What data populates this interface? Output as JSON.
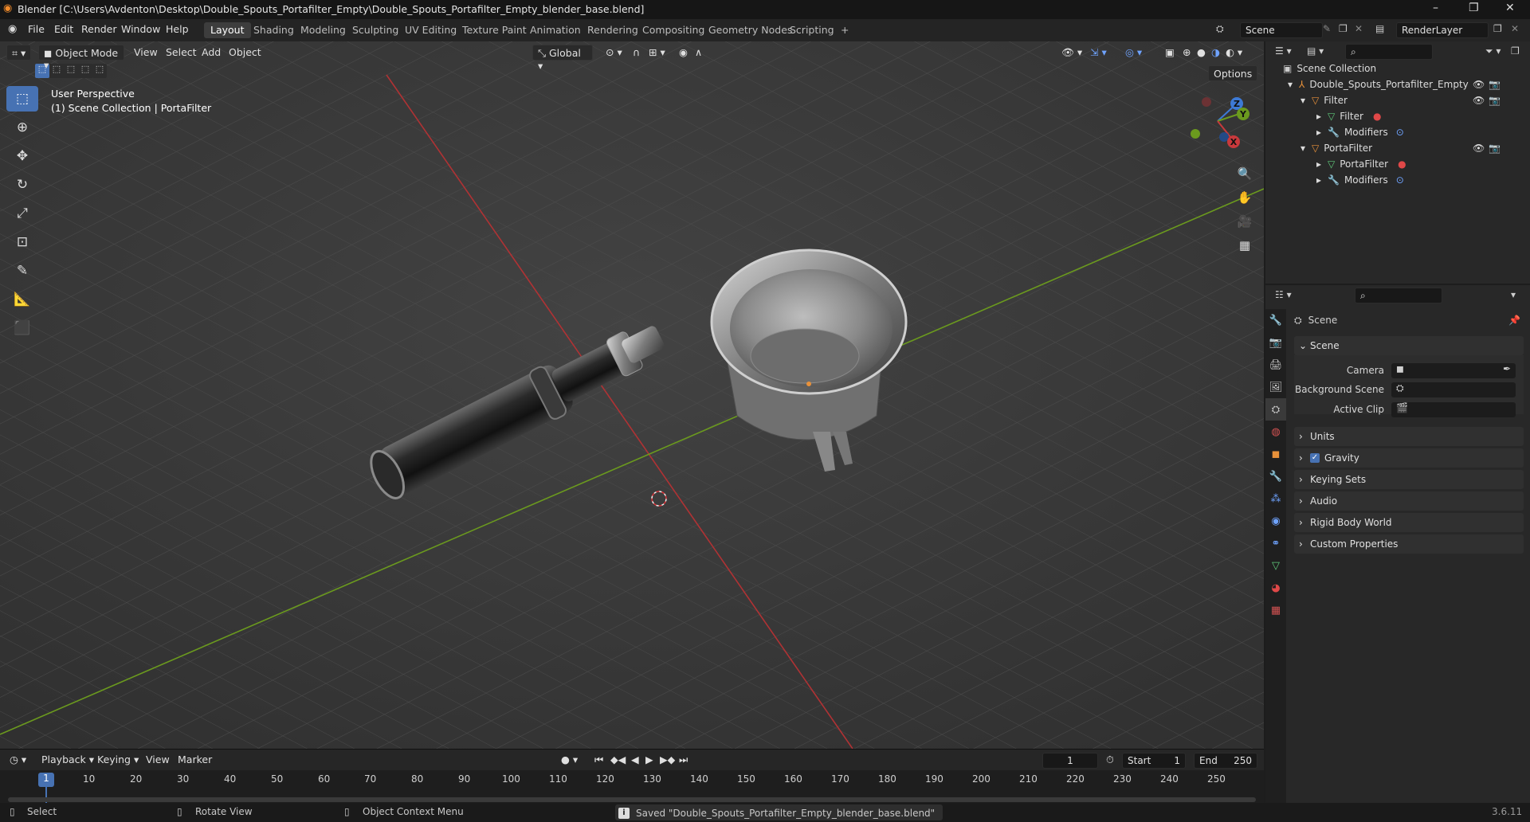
{
  "window": {
    "title": "Blender [C:\\Users\\Avdenton\\Desktop\\Double_Spouts_Portafilter_Empty\\Double_Spouts_Portafilter_Empty_blender_base.blend]",
    "minimize": "–",
    "maximize": "❐",
    "close": "✕"
  },
  "menu": [
    "File",
    "Edit",
    "Render",
    "Window",
    "Help"
  ],
  "workspaces": [
    "Layout",
    "Shading",
    "Modeling",
    "Sculpting",
    "UV Editing",
    "Texture Paint",
    "Animation",
    "Rendering",
    "Compositing",
    "Geometry Nodes",
    "Scripting",
    "+"
  ],
  "scene_name": "Scene",
  "render_layer": "RenderLayer",
  "viewport": {
    "mode": "Object Mode",
    "menus": [
      "View",
      "Select",
      "Add",
      "Object"
    ],
    "transform_orientation": "Global",
    "options": "Options",
    "perspective": "User Perspective",
    "collection": "(1) Scene Collection | PortaFilter",
    "gizmo": {
      "z": "Z",
      "y": "Y",
      "x": "X"
    }
  },
  "tools": [
    "select-box",
    "cursor",
    "move",
    "rotate",
    "scale",
    "transform",
    "annotate",
    "measure",
    "add-cube"
  ],
  "outliner": {
    "root": "Scene Collection",
    "items": [
      {
        "label": "Double_Spouts_Portafilter_Empty",
        "level": 0
      },
      {
        "label": "Filter",
        "level": 1
      },
      {
        "label": "Filter",
        "level": 2
      },
      {
        "label": "Modifiers",
        "level": 2
      },
      {
        "label": "PortaFilter",
        "level": 1
      },
      {
        "label": "PortaFilter",
        "level": 2
      },
      {
        "label": "Modifiers",
        "level": 2
      }
    ]
  },
  "properties": {
    "header": "Scene",
    "section": "Scene",
    "fields": [
      "Camera",
      "Background Scene",
      "Active Clip"
    ],
    "panels": [
      "Units",
      "Gravity",
      "Keying Sets",
      "Audio",
      "Rigid Body World",
      "Custom Properties"
    ],
    "gravity_checked": true
  },
  "timeline": {
    "menus": [
      "Playback",
      "Keying",
      "View",
      "Marker"
    ],
    "current_frame": "1",
    "start_label": "Start",
    "start": "1",
    "end_label": "End",
    "end": "250",
    "ruler": [
      "1",
      "10",
      "20",
      "30",
      "40",
      "50",
      "60",
      "70",
      "80",
      "90",
      "100",
      "110",
      "120",
      "130",
      "140",
      "150",
      "160",
      "170",
      "180",
      "190",
      "200",
      "210",
      "220",
      "230",
      "240",
      "250"
    ]
  },
  "status": {
    "select": "Select",
    "rotate": "Rotate View",
    "context": "Object Context Menu",
    "message": "Saved \"Double_Spouts_Portafilter_Empty_blender_base.blend\"",
    "version": "3.6.11"
  },
  "colors": {
    "accent": "#4772b3",
    "x_axis": "#c8393c",
    "y_axis": "#6b9a1e",
    "z_axis": "#3d7ad6",
    "object_orange": "#e8913a",
    "mesh_green": "#5fc97a"
  }
}
